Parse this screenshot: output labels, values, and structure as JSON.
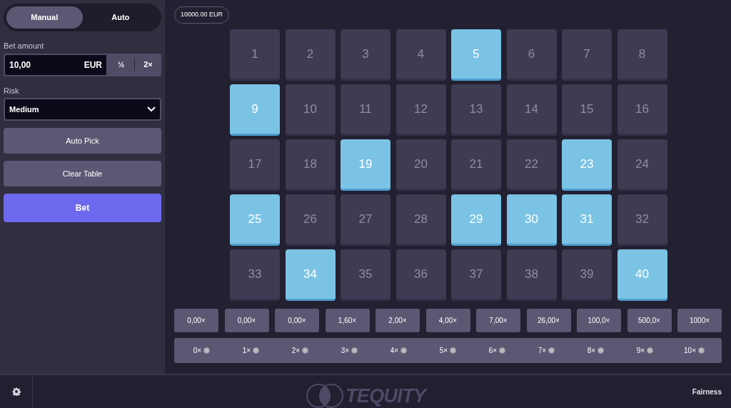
{
  "mode_tabs": [
    {
      "label": "Manual",
      "selected": true
    },
    {
      "label": "Auto",
      "selected": false
    }
  ],
  "bet_amount": {
    "label": "Bet amount",
    "value": "10,00",
    "currency": "EUR",
    "half": "½",
    "double": "2×"
  },
  "risk": {
    "label": "Risk",
    "value": "Medium"
  },
  "buttons": [
    "Auto Pick",
    "Clear Table"
  ],
  "bet_button": "Bet",
  "balance": "10000.00 EUR",
  "tiles": [
    {
      "number": "1",
      "selected": false
    },
    {
      "number": "2",
      "selected": false
    },
    {
      "number": "3",
      "selected": false
    },
    {
      "number": "4",
      "selected": false
    },
    {
      "number": "5",
      "selected": true
    },
    {
      "number": "6",
      "selected": false
    },
    {
      "number": "7",
      "selected": false
    },
    {
      "number": "8",
      "selected": false
    },
    {
      "number": "9",
      "selected": true
    },
    {
      "number": "10",
      "selected": false
    },
    {
      "number": "11",
      "selected": false
    },
    {
      "number": "12",
      "selected": false
    },
    {
      "number": "13",
      "selected": false
    },
    {
      "number": "14",
      "selected": false
    },
    {
      "number": "15",
      "selected": false
    },
    {
      "number": "16",
      "selected": false
    },
    {
      "number": "17",
      "selected": false
    },
    {
      "number": "18",
      "selected": false
    },
    {
      "number": "19",
      "selected": true
    },
    {
      "number": "20",
      "selected": false
    },
    {
      "number": "21",
      "selected": false
    },
    {
      "number": "22",
      "selected": false
    },
    {
      "number": "23",
      "selected": true
    },
    {
      "number": "24",
      "selected": false
    },
    {
      "number": "25",
      "selected": true
    },
    {
      "number": "26",
      "selected": false
    },
    {
      "number": "27",
      "selected": false
    },
    {
      "number": "28",
      "selected": false
    },
    {
      "number": "29",
      "selected": true
    },
    {
      "number": "30",
      "selected": true
    },
    {
      "number": "31",
      "selected": true
    },
    {
      "number": "32",
      "selected": false
    },
    {
      "number": "33",
      "selected": false
    },
    {
      "number": "34",
      "selected": true
    },
    {
      "number": "35",
      "selected": false
    },
    {
      "number": "36",
      "selected": false
    },
    {
      "number": "37",
      "selected": false
    },
    {
      "number": "38",
      "selected": false
    },
    {
      "number": "39",
      "selected": false
    },
    {
      "number": "40",
      "selected": true
    }
  ],
  "multipliers": [
    "0,00×",
    "0,00×",
    "0,00×",
    "1,60×",
    "2,00×",
    "4,00×",
    "7,00×",
    "26,00×",
    "100,0×",
    "500,0×",
    "1000×"
  ],
  "hits": [
    "0×",
    "1×",
    "2×",
    "3×",
    "4×",
    "5×",
    "6×",
    "7×",
    "8×",
    "9×",
    "10×"
  ],
  "footer": {
    "logo": "TEQUITY",
    "link": "Fairness"
  }
}
